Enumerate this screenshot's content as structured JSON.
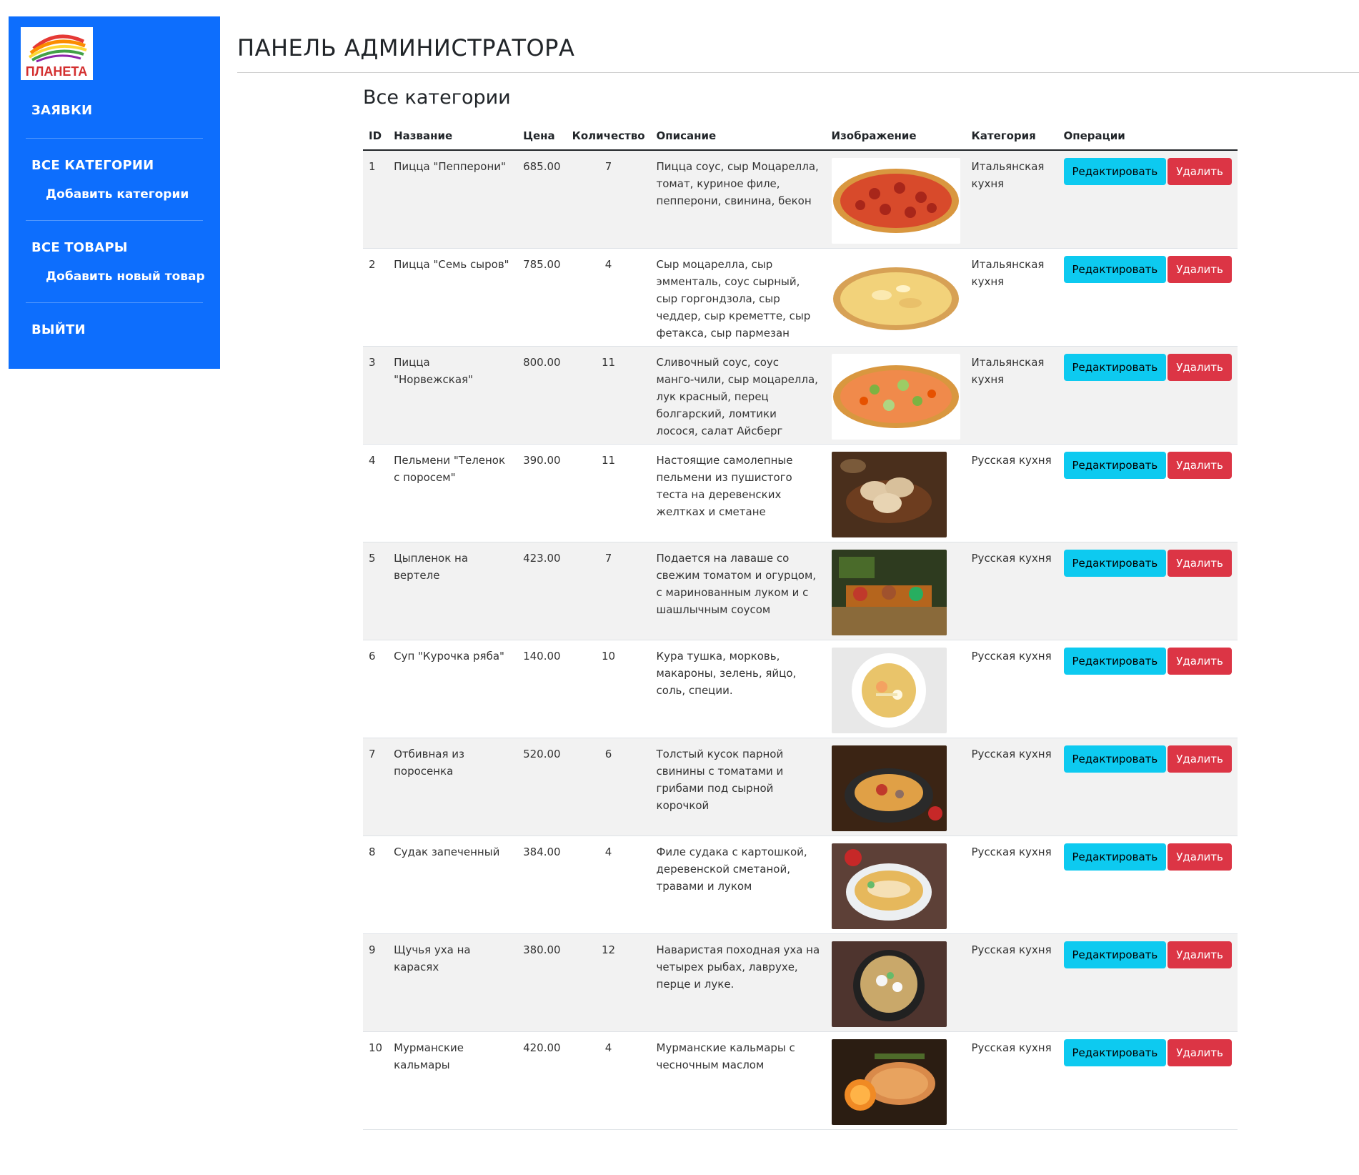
{
  "sidebar": {
    "logo_text": "ПЛАНЕТА",
    "items": [
      {
        "label": "ЗАЯВКИ"
      },
      {
        "label": "ВСЕ КАТЕГОРИИ",
        "sub": "Добавить категории"
      },
      {
        "label": "ВСЕ ТОВАРЫ",
        "sub": "Добавить новый товар"
      },
      {
        "label": "ВЫЙТИ"
      }
    ]
  },
  "header": {
    "title": "ПАНЕЛЬ АДМИНИСТРАТОРА"
  },
  "main": {
    "title": "Все категории",
    "columns": [
      "ID",
      "Название",
      "Цена",
      "Количество",
      "Описание",
      "Изображение",
      "Категория",
      "Операции"
    ],
    "edit_label": "Редактировать",
    "delete_label": "Удалить",
    "rows": [
      {
        "id": "1",
        "name": "Пицца \"Пепперони\"",
        "price": "685.00",
        "qty": "7",
        "desc": "Пицца соус, сыр Моцарелла, томат, куриное филе, пепперони, свинина, бекон",
        "category": "Итальянская кухня",
        "image": "pizza-pepperoni"
      },
      {
        "id": "2",
        "name": "Пицца \"Семь сыров\"",
        "price": "785.00",
        "qty": "4",
        "desc": "Сыр моцарелла, сыр эмменталь, соус сырный, сыр горгондзола, сыр чеддер, сыр креметте, сыр фетакса, сыр пармезан",
        "category": "Итальянская кухня",
        "image": "pizza-cheese"
      },
      {
        "id": "3",
        "name": "Пицца \"Норвежская\"",
        "price": "800.00",
        "qty": "11",
        "desc": "Сливочный соус, соус манго-чили, сыр моцарелла, лук красный, перец болгарский, ломтики лосося, салат Айсберг",
        "category": "Итальянская кухня",
        "image": "pizza-norwegian"
      },
      {
        "id": "4",
        "name": "Пельмени \"Теленок с поросем\"",
        "price": "390.00",
        "qty": "11",
        "desc": "Настоящие самолепные пельмени из пушистого теста на деревенских желтках и сметане",
        "category": "Русская кухня",
        "image": "pelmeni"
      },
      {
        "id": "5",
        "name": "Цыпленок на вертеле",
        "price": "423.00",
        "qty": "7",
        "desc": "Подается на лаваше со свежим томатом и огурцом, с маринованным луком и с шашлычным соусом",
        "category": "Русская кухня",
        "image": "chicken-skewer"
      },
      {
        "id": "6",
        "name": "Суп \"Курочка ряба\"",
        "price": "140.00",
        "qty": "10",
        "desc": "Кура тушка, морковь, макароны, зелень, яйцо, соль, специи.",
        "category": "Русская кухня",
        "image": "soup"
      },
      {
        "id": "7",
        "name": "Отбивная из поросенка",
        "price": "520.00",
        "qty": "6",
        "desc": "Толстый кусок парной свинины с томатами и грибами под сырной корочкой",
        "category": "Русская кухня",
        "image": "pork-chop"
      },
      {
        "id": "8",
        "name": "Судак запеченный",
        "price": "384.00",
        "qty": "4",
        "desc": "Филе судака с картошкой, деревенской сметаной, травами и луком",
        "category": "Русская кухня",
        "image": "baked-fish"
      },
      {
        "id": "9",
        "name": "Щучья уха на карасях",
        "price": "380.00",
        "qty": "12",
        "desc": "Наваристая походная уха на четырех рыбах, лаврухе, перце и луке.",
        "category": "Русская кухня",
        "image": "fish-soup"
      },
      {
        "id": "10",
        "name": "Мурманские кальмары",
        "price": "420.00",
        "qty": "4",
        "desc": "Мурманские кальмары с чесночным маслом",
        "category": "Русская кухня",
        "image": "grilled-squid"
      }
    ]
  },
  "colors": {
    "sidebar": "#0d6efd",
    "edit": "#0dcaf0",
    "delete": "#dc3545"
  }
}
